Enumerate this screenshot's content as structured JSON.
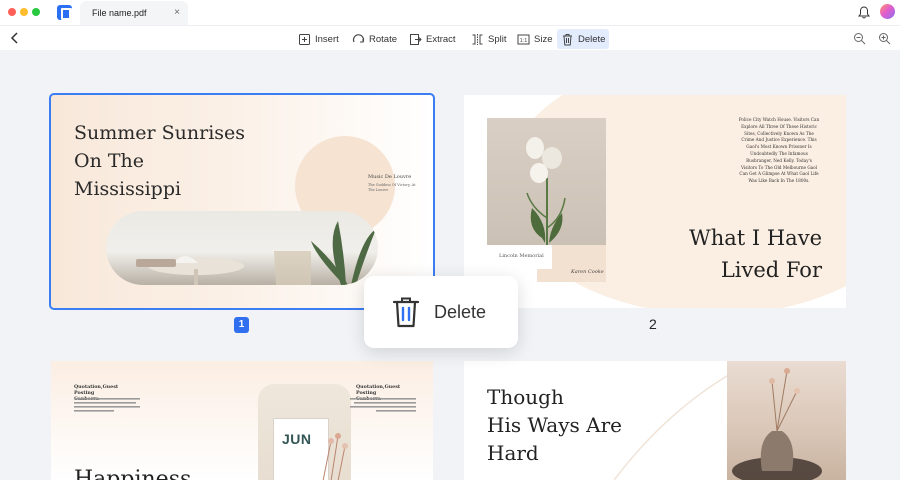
{
  "titlebar": {
    "tab_title": "File name.pdf",
    "tab_close": "×"
  },
  "toolbar": {
    "tools": [
      {
        "label": "Insert",
        "icon": "insert-icon"
      },
      {
        "label": "Rotate",
        "icon": "rotate-icon"
      },
      {
        "label": "Extract",
        "icon": "extract-icon"
      },
      {
        "label": "Split",
        "icon": "split-icon"
      },
      {
        "label": "Size",
        "icon": "size-icon"
      },
      {
        "label": "Delete",
        "icon": "trash-icon",
        "active": true
      }
    ]
  },
  "pages": {
    "p1": {
      "title": "Summer Sunrises\nOn The\nMississippi",
      "small_title": "Music De Louvre",
      "small_body": "The Goddess Of Victory, At The Louvre",
      "number": "1"
    },
    "p2": {
      "caption": "Lincoln Memorial",
      "author": "Karen Cooke",
      "body": "Police City Watch House. Visitors Can\nExplore All Three Of These Historic\nSites, Collectively Known As The\nCrime And Justice Experience. This\nGaol's Most Known Prisoner Is\nUndoubtedly The Infamous\nBushranger, Ned Kelly. Today's\nVisitors To The Old Melbourne Gaol\nCan Get A Glimpse At What Gaol Life\nWas Like Back In The 1800s.",
      "title": "What I Have\nLived For",
      "number": "2"
    },
    "p3": {
      "left_title": "Quotation,Guest Posting\nCanberra",
      "right_title": "Quotation,Guest Posting\nCanberra",
      "calendar_label": "JUN",
      "big_title": "Happiness"
    },
    "p4": {
      "title": "Though\nHis Ways Are\nHard"
    }
  },
  "popup": {
    "label": "Delete"
  },
  "colors": {
    "accent": "#2f6ff0",
    "toolbar_active_bg": "#e3ecfd",
    "background": "#f1f3f7"
  }
}
